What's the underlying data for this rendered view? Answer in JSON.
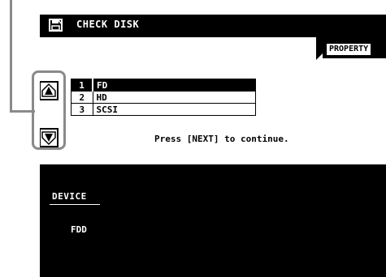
{
  "header": {
    "title": "CHECK DISK",
    "icon": "disk-icon"
  },
  "tabs": [
    {
      "label": "PROPERTY",
      "icon": "triangle-right-icon"
    }
  ],
  "devices": [
    {
      "num": "1",
      "name": "FD",
      "selected": true
    },
    {
      "num": "2",
      "name": "HD",
      "selected": false
    },
    {
      "num": "3",
      "name": "SCSI",
      "selected": false
    }
  ],
  "hint": "Press [NEXT] to continue.",
  "scroll": {
    "up_icon": "arrow-up-icon",
    "down_icon": "arrow-down-icon"
  },
  "status": {
    "device_label": "DEVICE",
    "device_value": "FDD"
  },
  "colors": {
    "screen_bg": "#000000",
    "panel_bg": "#ffffff",
    "callout": "#8a8a8a"
  }
}
